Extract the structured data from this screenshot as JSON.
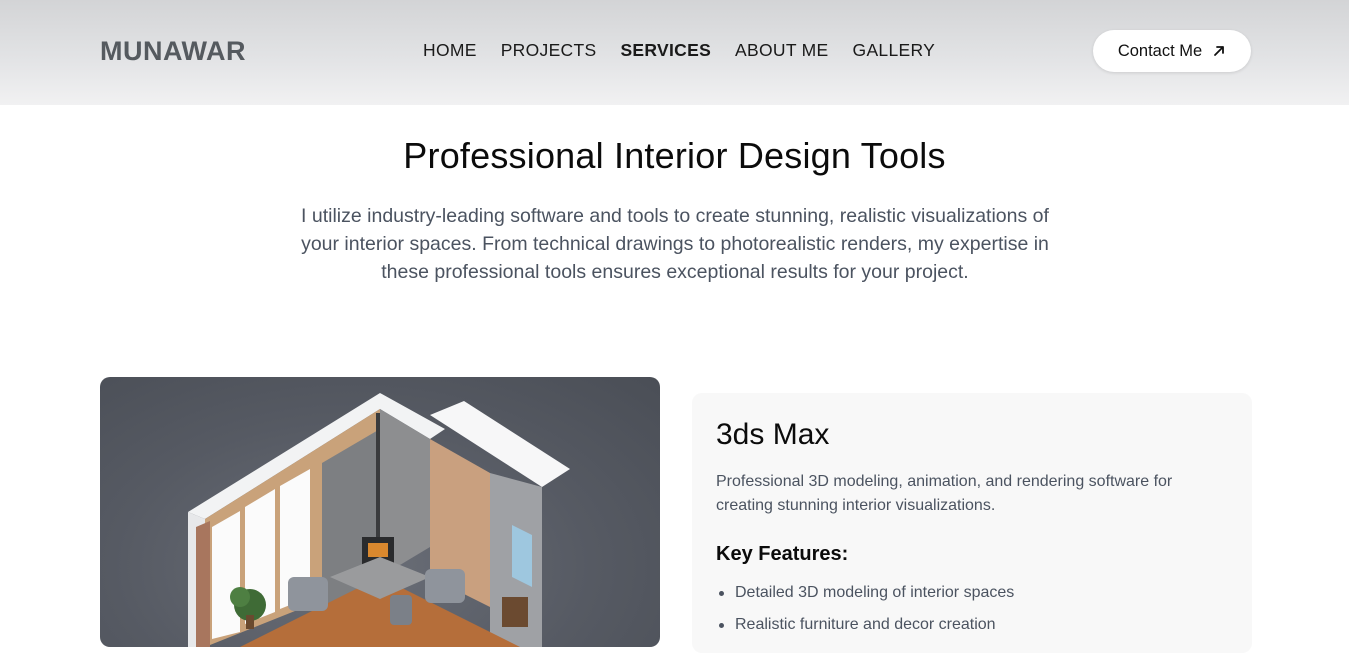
{
  "header": {
    "logo": "MUNAWAR",
    "nav": [
      {
        "label": "HOME",
        "active": false
      },
      {
        "label": "PROJECTS",
        "active": false
      },
      {
        "label": "SERVICES",
        "active": true
      },
      {
        "label": "ABOUT ME",
        "active": false
      },
      {
        "label": "GALLERY",
        "active": false
      }
    ],
    "contact_label": "Contact Me",
    "contact_icon": "arrow-up-right-icon"
  },
  "hero": {
    "title": "Professional Interior Design Tools",
    "description": "I utilize industry-leading software and tools to create stunning, realistic visualizations of your interior spaces. From technical drawings to photorealistic renders, my expertise in these professional tools ensures exceptional results for your project."
  },
  "tool": {
    "image_alt": "isometric-room-render",
    "title": "3ds Max",
    "description": "Professional 3D modeling, animation, and rendering software for creating stunning interior visualizations.",
    "features_title": "Key Features:",
    "features": [
      "Detailed 3D modeling of interior spaces",
      "Realistic furniture and decor creation"
    ]
  },
  "colors": {
    "logo": "#555a5f",
    "body_text": "#4b5360",
    "card_bg": "#f8f8f8",
    "image_bg": "#565a63"
  }
}
